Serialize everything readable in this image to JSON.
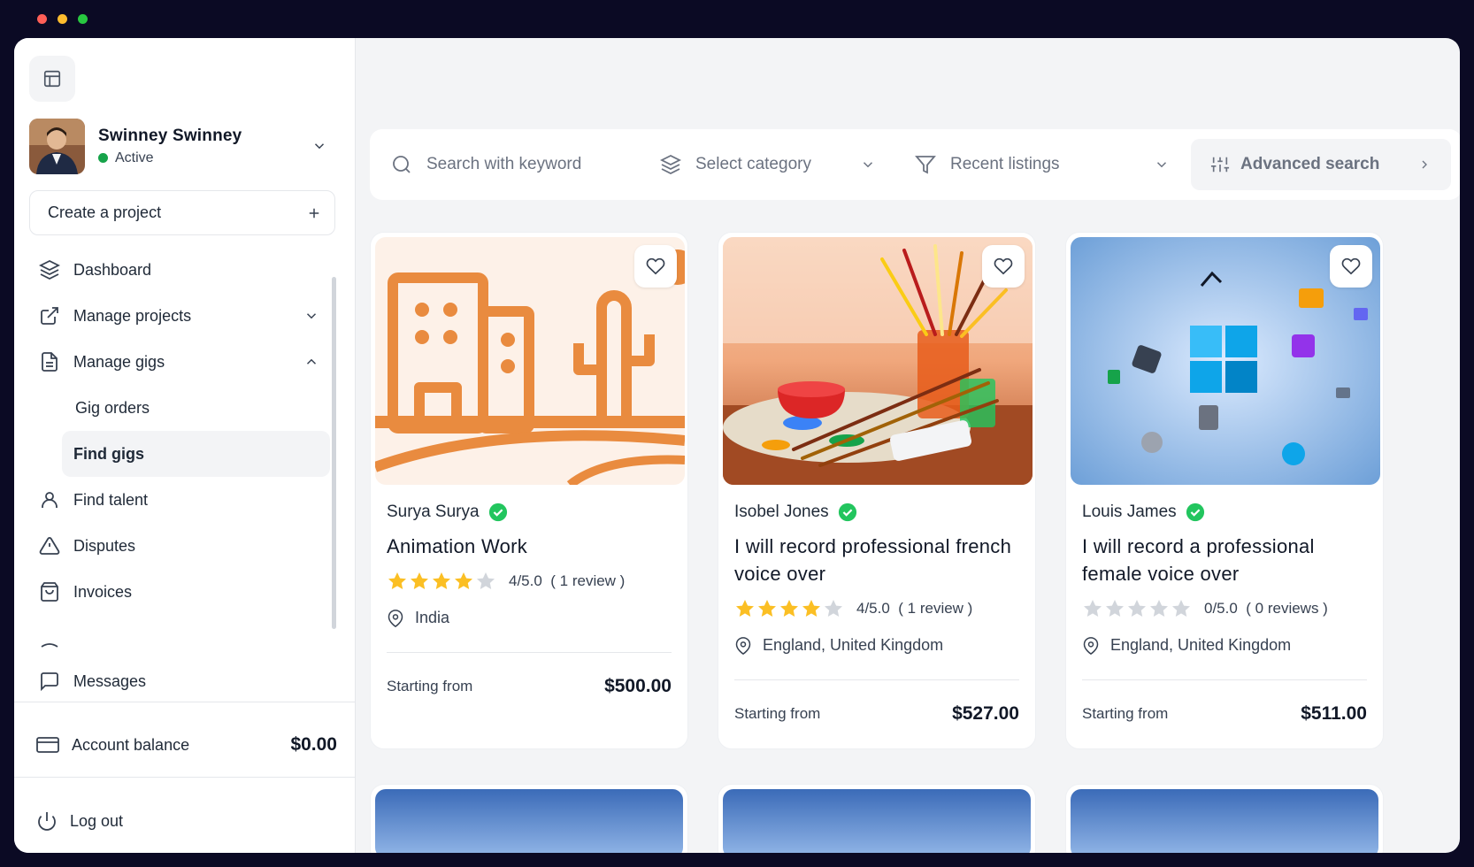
{
  "window": {
    "dots": [
      "#ff5f57",
      "#febc2e",
      "#28c840"
    ]
  },
  "sidebar": {
    "user": {
      "name": "Swinney Swinney",
      "status": "Active"
    },
    "create_label": "Create a project",
    "items": [
      {
        "label": "Dashboard"
      },
      {
        "label": "Manage projects"
      },
      {
        "label": "Manage gigs"
      },
      {
        "label": "Gig orders"
      },
      {
        "label": "Find gigs"
      },
      {
        "label": "Find talent"
      },
      {
        "label": "Disputes"
      },
      {
        "label": "Invoices"
      }
    ],
    "messages_label": "Messages",
    "balance_label": "Account balance",
    "balance_value": "$0.00",
    "logout_label": "Log out"
  },
  "filters": {
    "search_placeholder": "Search with keyword",
    "category_label": "Select category",
    "sort_label": "Recent listings",
    "advanced_label": "Advanced search"
  },
  "gigs": [
    {
      "seller": "Surya Surya",
      "title": "Animation Work",
      "rating_value": 4,
      "rating_text": "4/5.0",
      "reviews": "( 1 review )",
      "location": "India",
      "price_label": "Starting from",
      "price": "$500.00",
      "image": "city-illustration"
    },
    {
      "seller": "Isobel Jones",
      "title": "I will record professional french voice over",
      "rating_value": 4,
      "rating_text": "4/5.0",
      "reviews": "( 1 review )",
      "location": "England, United Kingdom",
      "price_label": "Starting from",
      "price": "$527.00",
      "image": "paint-brushes-photo"
    },
    {
      "seller": "Louis James",
      "title": "I will record a professional female voice over",
      "rating_value": 0,
      "rating_text": "0/5.0",
      "reviews": "( 0 reviews )",
      "location": "England, United Kingdom",
      "price_label": "Starting from",
      "price": "$511.00",
      "image": "windows-icons-photo"
    }
  ],
  "colors": {
    "verified": "#22c55e",
    "star": "#fbbf24",
    "star_empty": "#d1d5db",
    "illustration": "#e98b3f"
  }
}
